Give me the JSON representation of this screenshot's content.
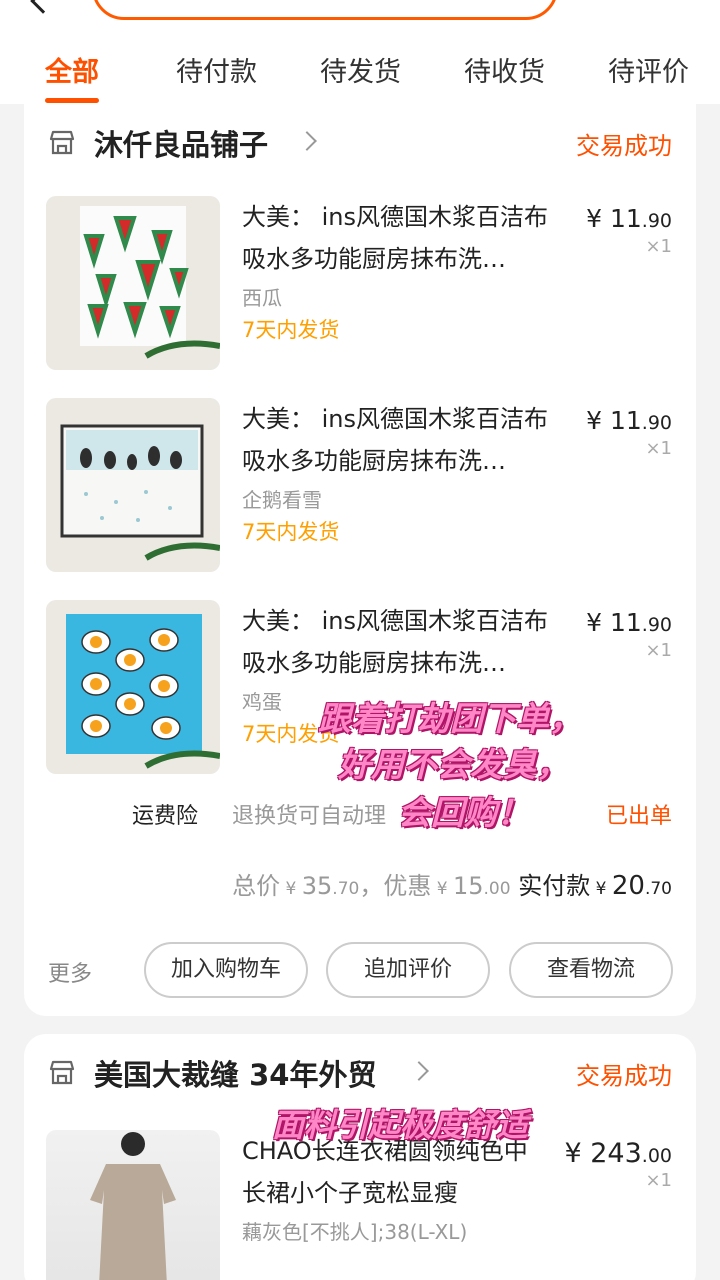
{
  "tabs": [
    {
      "label": "全部",
      "active": true
    },
    {
      "label": "待付款"
    },
    {
      "label": "待发货"
    },
    {
      "label": "待收货"
    },
    {
      "label": "待评价"
    }
  ],
  "orders": [
    {
      "shop": "沐仟良品铺子",
      "status": "交易成功",
      "items": [
        {
          "title": "大美： ins风德国木浆百洁布吸水多功能厨房抹布洗…",
          "variant": "西瓜",
          "ship": "7天内发货",
          "price_int": "11",
          "price_dec": ".90",
          "qty": "×1",
          "currency": "¥"
        },
        {
          "title": "大美： ins风德国木浆百洁布吸水多功能厨房抹布洗…",
          "variant": "企鹅看雪",
          "ship": "7天内发货",
          "price_int": "11",
          "price_dec": ".90",
          "qty": "×1",
          "currency": "¥"
        },
        {
          "title": "大美： ins风德国木浆百洁布吸水多功能厨房抹布洗…",
          "variant": "鸡蛋",
          "ship": "7天内发货",
          "price_int": "11",
          "price_dec": ".90",
          "qty": "×1",
          "currency": "¥"
        }
      ],
      "insurance": {
        "label": "运费险",
        "desc": "退换货可自动理",
        "status": "已出单"
      },
      "totals": {
        "total_label": "总价",
        "total_int": "35",
        "total_dec": ".70",
        "discount_label": "，优惠",
        "discount_int": "15",
        "discount_dec": ".00",
        "pay_label": "实付款",
        "pay_int": "20",
        "pay_dec": ".70",
        "currency": "¥"
      },
      "more_label": "更多",
      "buttons": [
        "加入购物车",
        "追加评价",
        "查看物流"
      ]
    },
    {
      "shop": "美国大裁缝 34年外贸",
      "status": "交易成功",
      "items": [
        {
          "title": "CHAO长连衣裙圆领纯色中长裙小个子宽松显瘦",
          "variant": "藕灰色[不挑人];38(L-XL)",
          "price_int": "243",
          "price_dec": ".00",
          "qty": "×1",
          "currency": "¥"
        }
      ]
    }
  ],
  "overlay_text": [
    "跟着打劫团下单，",
    "好用不会发臭，",
    "会回购！",
    "面料引起极度舒适"
  ],
  "colors": {
    "accent": "#ff5000",
    "ship_orange": "#ff9f00",
    "overlay_pink": "#ff86c7"
  },
  "icons": [
    "back-icon",
    "shop-icon",
    "chevron-right-icon"
  ]
}
